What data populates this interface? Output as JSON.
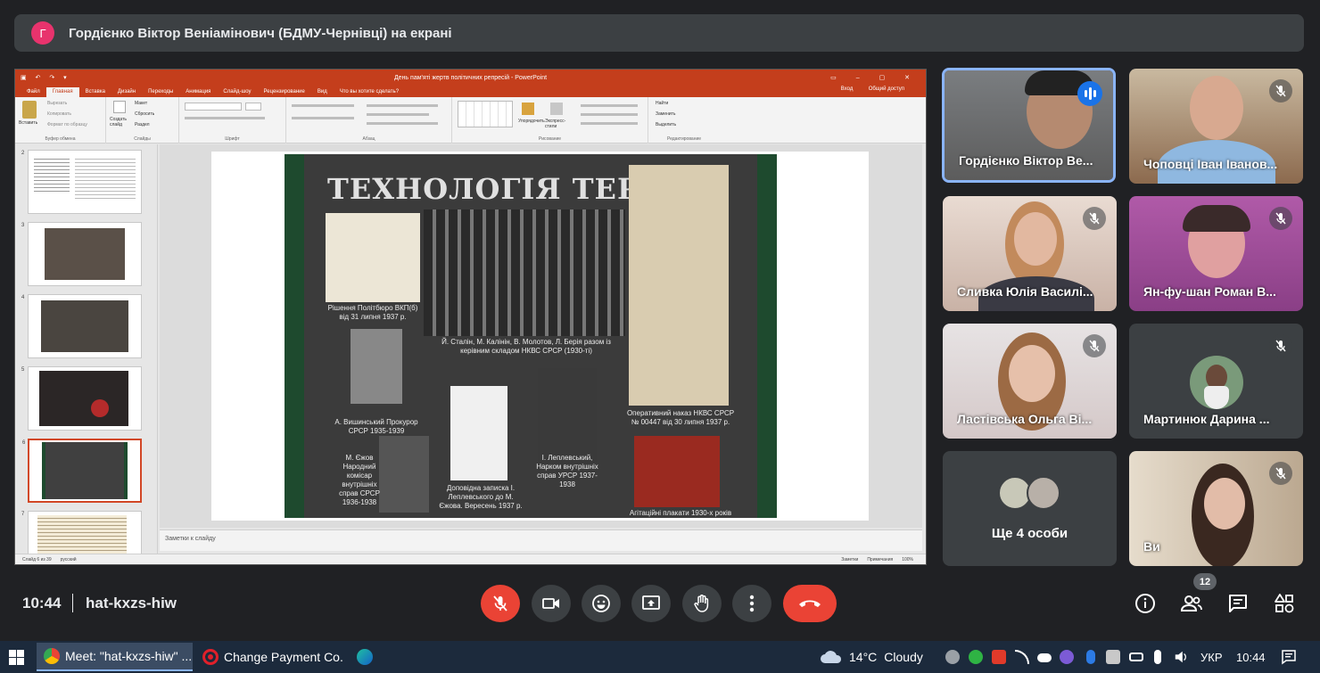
{
  "presentation_banner": {
    "avatar_letter": "Г",
    "text": "Гордієнко Віктор Веніамінович (БДМУ-Чернівці) на екрані"
  },
  "powerpoint": {
    "window_title": "День пам'яті жертв політичних репресій - PowerPoint",
    "tabs": [
      "Файл",
      "Главная",
      "Вставка",
      "Дизайн",
      "Переходы",
      "Анимация",
      "Слайд-шоу",
      "Рецензирование",
      "Вид"
    ],
    "tell_me": "Что вы хотите сделать?",
    "sign_in": "Вход",
    "share": "Общий доступ",
    "ribbon_groups": [
      "Буфер обмена",
      "Слайды",
      "Шрифт",
      "Абзац",
      "Рисование",
      "Редактирование"
    ],
    "ribbon_labels": {
      "paste": "Вставить",
      "cut": "Вырезать",
      "copy": "Копировать",
      "format_painter": "Формат по образцу",
      "new_slide": "Создать слайд",
      "layout": "Макет",
      "reset": "Сбросить",
      "section": "Раздел",
      "arrange": "Упорядочить",
      "quick_styles": "Экспресс-стили",
      "find": "Найти",
      "replace": "Заменить",
      "select": "Выделить"
    },
    "slide_numbers": [
      "2",
      "3",
      "4",
      "5",
      "6",
      "7"
    ],
    "selected_slide": "6",
    "notes_placeholder": "Заметки к слайду",
    "status_left": "Слайд 6 из 39",
    "status_lang": "русский",
    "status_notes": "Заметки",
    "status_comments": "Примечания",
    "zoom": "100%"
  },
  "slide": {
    "poster_title": "ТЕХНОЛОГІЯ ТЕРОРУ",
    "captions": {
      "politburo": "Рішення Політбюро ВКП(б) від 31 липня 1937 р.",
      "stalin": "Й. Сталін, М. Калінін, В. Молотов, Л. Берія разом із керівним складом НКВС СРСР (1930-ті)",
      "vyshinsky": "А. Вишинський Прокурор СРСР 1935-1939",
      "yezhov": "М. Єжов Народний комісар внутрішніх справ СРСР 1936-1938",
      "note": "Доповідна записка І. Леплевського до М. Єжова. Вересень 1937 р.",
      "leplevsky": "І. Леплевський, Нарком внутрішніх справ УРСР 1937-1938",
      "order": "Оперативний наказ НКВС СРСР № 00447 від 30 липня 1937 р.",
      "posters": "Агітаційні плакати 1930-х років"
    }
  },
  "participants": [
    {
      "name": "Гордієнко Віктор Ве...",
      "state": "speaking"
    },
    {
      "name": "Чоповці Іван Іванов...",
      "state": "muted"
    },
    {
      "name": "Сливка Юлія Василі...",
      "state": "muted"
    },
    {
      "name": "Ян-фу-шан Роман В...",
      "state": "muted"
    },
    {
      "name": "Ластівська Ольга Ві...",
      "state": "muted"
    },
    {
      "name": "Мартинюк Дарина ...",
      "state": "muted"
    },
    {
      "name": "Ще 4 особи",
      "state": "overflow"
    },
    {
      "name": "Ви",
      "state": "muted"
    }
  ],
  "meeting": {
    "time": "10:44",
    "code": "hat-kxzs-hiw",
    "participant_count": "12"
  },
  "taskbar": {
    "items": [
      {
        "label": "Meet: \"hat-kxzs-hiw\" ..."
      },
      {
        "label": "Change Payment Co..."
      }
    ],
    "weather_temp": "14°C",
    "weather_text": "Cloudy",
    "language": "УКР",
    "clock": "10:44"
  },
  "colors": {
    "meet_bg": "#202124",
    "tile_bg": "#3c4043",
    "danger": "#ea4335",
    "accent": "#8ab4f8",
    "ppt_brand": "#c43e1c"
  }
}
